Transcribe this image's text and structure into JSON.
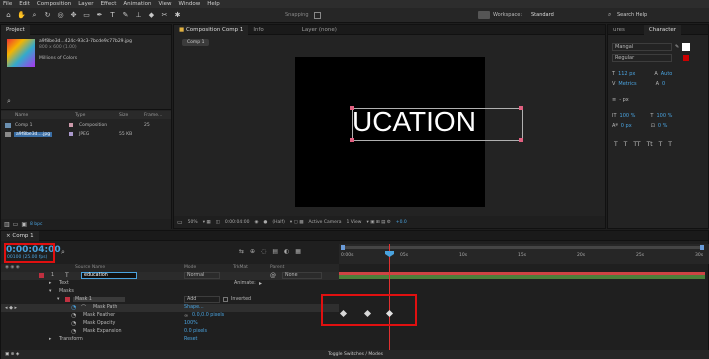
{
  "menu": [
    "File",
    "Edit",
    "Composition",
    "Layer",
    "Effect",
    "Animation",
    "View",
    "Window",
    "Help"
  ],
  "toolbar": {
    "tools": [
      "home-icon",
      "hand-icon",
      "zoom-icon",
      "rotate-icon",
      "camera-icon",
      "pan-icon",
      "rect-icon",
      "pen-icon",
      "text-icon",
      "brush-icon",
      "stamp-icon",
      "eraser-icon",
      "roto-icon",
      "puppet-icon"
    ],
    "snapping": "Snapping",
    "workspace_label": "Workspace:",
    "workspace_value": "Standard",
    "search_placeholder": "Search Help"
  },
  "project": {
    "tab": "Project",
    "filename": "a9f8be3d...424c-93c3-7bcde9c77b29.jpg",
    "dims": "800 x 600 (1.00)",
    "colors": "Millions of Colors",
    "columns": [
      "Name",
      "Type",
      "Size",
      "Frame..."
    ],
    "items": [
      {
        "name": "Comp 1",
        "type": "Composition",
        "size": "",
        "frame": "25"
      },
      {
        "name": "a9f8be3d....jpg",
        "type": "JPEG",
        "size": "55 KB",
        "frame": ""
      }
    ],
    "bpc": "8 bpc"
  },
  "composition": {
    "tab": "Composition Comp 1",
    "info_tab": "Info",
    "layer_tab": "Layer (none)",
    "comp_pill": "Comp 1",
    "text": "UCATION",
    "zoom": "50%",
    "timecode": "0:00:04:00",
    "resolution": "(Half)",
    "camera": "Active Camera",
    "view": "1 View",
    "offset": "+0.0"
  },
  "character": {
    "tabs": [
      "ures",
      "Character"
    ],
    "font": "Mangal",
    "style": "Regular",
    "size": "112 px",
    "leading": "Auto",
    "kerning": "Metrics",
    "tracking": "0",
    "stroke": "- px",
    "vscale": "100 %",
    "hscale": "100 %",
    "baseline": "0 px",
    "tsume": "0 %",
    "styles": [
      "T",
      "T",
      "TT",
      "Tt",
      "T",
      "T"
    ]
  },
  "timeline": {
    "tab": "Comp 1",
    "timecode": "0:00:04:00",
    "fps": "00100 (25.00 fps)",
    "col_source": "Source Name",
    "col_mode": "Mode",
    "col_trkmat": "TrkMat",
    "col_parent": "Parent",
    "layer_num": "1",
    "layer_name": "education",
    "layer_mode": "Normal",
    "parent": "None",
    "text_prop": "Text",
    "animate": "Animate:",
    "masks": "Masks",
    "mask1": "Mask 1",
    "mask_mode": "Add",
    "inverted": "Inverted",
    "mask_path": "Mask Path",
    "mask_path_val": "Shape...",
    "mask_feather": "Mask Feather",
    "mask_feather_val": "0.0,0.0 pixels",
    "mask_opacity": "Mask Opacity",
    "mask_opacity_val": "100%",
    "mask_expansion": "Mask Expansion",
    "mask_expansion_val": "0.0 pixels",
    "transform": "Transform",
    "reset": "Reset",
    "toggle": "Toggle Switches / Modes",
    "ruler": [
      "0:00s",
      "05s",
      "10s",
      "15s",
      "20s",
      "25s",
      "30s"
    ]
  }
}
